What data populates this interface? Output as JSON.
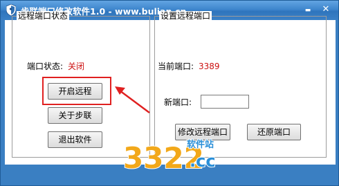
{
  "window": {
    "title": "步联端口修改软件1.0 - www.bulian.cn",
    "minimize_glyph": "▬",
    "close_glyph": "✕"
  },
  "left_group": {
    "title": "远程端口状态",
    "status_label": "端口状态:",
    "status_value": "关闭",
    "buttons": {
      "enable_remote": "开启远程",
      "about": "关于步联",
      "exit": "退出软件"
    }
  },
  "right_group": {
    "title": "设置远程端口",
    "current_port_label": "当前端口:",
    "current_port_value": "3389",
    "new_port_label": "新端口:",
    "new_port_value": "",
    "buttons": {
      "modify_port": "修改远程端口",
      "restore_port": "还原端口"
    }
  },
  "watermark": {
    "number": "3322",
    "suffix": ".cc",
    "site_label": "软件站"
  },
  "colors": {
    "titlebar": "#3a80c6",
    "accent_red": "#cc1010",
    "highlight_red": "#e02020"
  },
  "icons": {
    "app": "shield-icon",
    "annotation": "red-arrow-icon"
  }
}
